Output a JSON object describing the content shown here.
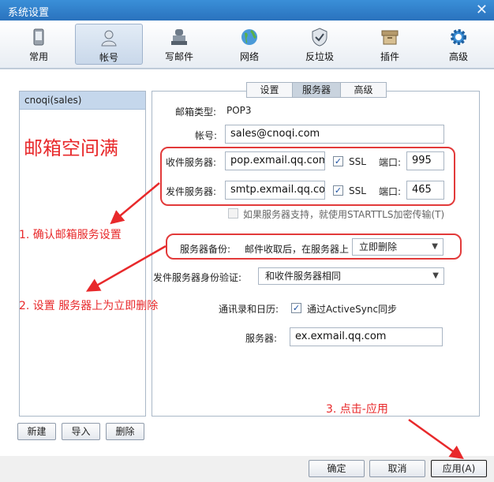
{
  "window": {
    "title": "系统设置",
    "close_glyph": "✕"
  },
  "toolbar": [
    {
      "label": "常用",
      "icon": "phone-icon"
    },
    {
      "label": "帐号",
      "icon": "user-icon",
      "selected": true
    },
    {
      "label": "写邮件",
      "icon": "stamp-icon"
    },
    {
      "label": "网络",
      "icon": "globe-icon"
    },
    {
      "label": "反垃圾",
      "icon": "shield-icon"
    },
    {
      "label": "插件",
      "icon": "box-icon"
    },
    {
      "label": "高级",
      "icon": "gear-icon"
    }
  ],
  "accounts": [
    "cnoqi(sales)"
  ],
  "tabs": [
    "设置",
    "服务器",
    "高级"
  ],
  "form": {
    "mailbox_type_label": "邮箱类型:",
    "mailbox_type_value": "POP3",
    "account_label": "帐号:",
    "account_value": "sales@cnoqi.com",
    "incoming_label": "收件服务器:",
    "incoming_value": "pop.exmail.qq.com",
    "outgoing_label": "发件服务器:",
    "outgoing_value": "smtp.exmail.qq.com",
    "ssl_label": "SSL",
    "port_label": "端口:",
    "incoming_port": "995",
    "outgoing_port": "465",
    "starttls_label": "如果服务器支持，就使用STARTTLS加密传输(T)",
    "backup_label": "服务器备份:",
    "backup_text": "邮件收取后，在服务器上",
    "backup_value": "立即删除",
    "auth_label": "发件服务器身份验证:",
    "auth_value": "和收件服务器相同",
    "contacts_label": "通讯录和日历:",
    "activesync_label": "通过ActiveSync同步",
    "server_label": "服务器:",
    "server_value": "ex.exmail.qq.com"
  },
  "account_buttons": {
    "new": "新建",
    "import": "导入",
    "delete": "删除"
  },
  "footer": {
    "ok": "确定",
    "cancel": "取消",
    "apply": "应用(A)"
  },
  "annotations": {
    "full": "邮箱空间满",
    "step1": "1. 确认邮箱服务设置",
    "step2": "2. 设置  服务器上为立即删除",
    "step3": "3. 点击-应用"
  },
  "colors": {
    "annotation": "#e8292b",
    "titlebar": "#2a72bd",
    "selected_tab": "#c9d3de"
  }
}
